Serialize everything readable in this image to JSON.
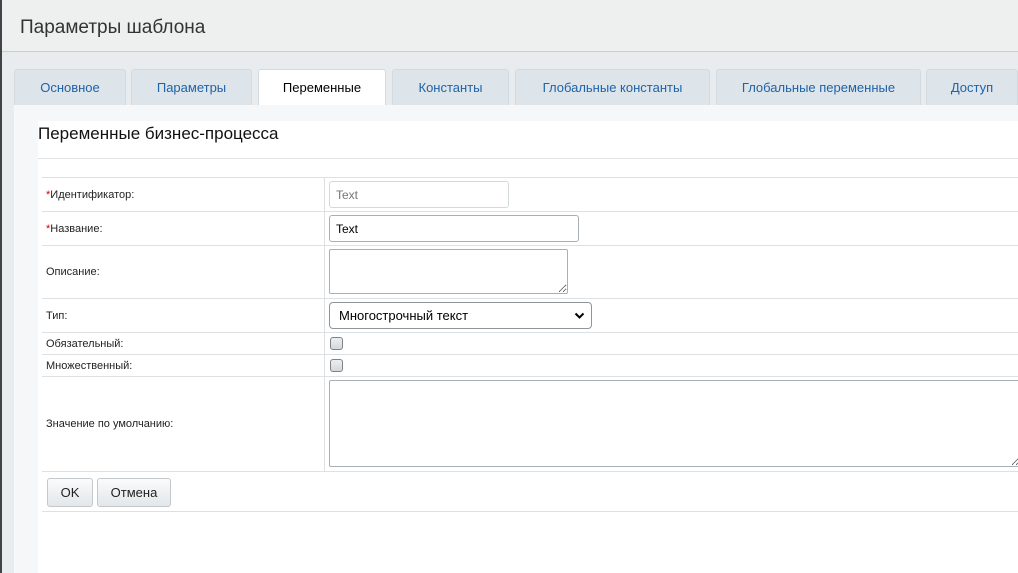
{
  "header": {
    "title": "Параметры шаблона"
  },
  "tabs": [
    {
      "label": "Основное"
    },
    {
      "label": "Параметры"
    },
    {
      "label": "Переменные",
      "active": true
    },
    {
      "label": "Константы"
    },
    {
      "label": "Глобальные константы"
    },
    {
      "label": "Глобальные переменные"
    },
    {
      "label": "Доступ"
    }
  ],
  "section": {
    "title": "Переменные бизнес-процесса"
  },
  "form": {
    "required_mark": "*",
    "identifier": {
      "label": "Идентификатор:",
      "placeholder": "Text",
      "value": ""
    },
    "name": {
      "label": "Название:",
      "value": "Text"
    },
    "description": {
      "label": "Описание:",
      "value": ""
    },
    "type": {
      "label": "Тип:",
      "selected": "Многострочный текст"
    },
    "required": {
      "label": "Обязательный:",
      "checked": false
    },
    "multiple": {
      "label": "Множественный:",
      "checked": false
    },
    "default_value": {
      "label": "Значение по умолчанию:",
      "value": ""
    }
  },
  "buttons": {
    "ok": "OK",
    "cancel": "Отмена"
  },
  "colors": {
    "link": "#2063a8",
    "required": "#d60000",
    "page_bg": "#e9ecee"
  }
}
